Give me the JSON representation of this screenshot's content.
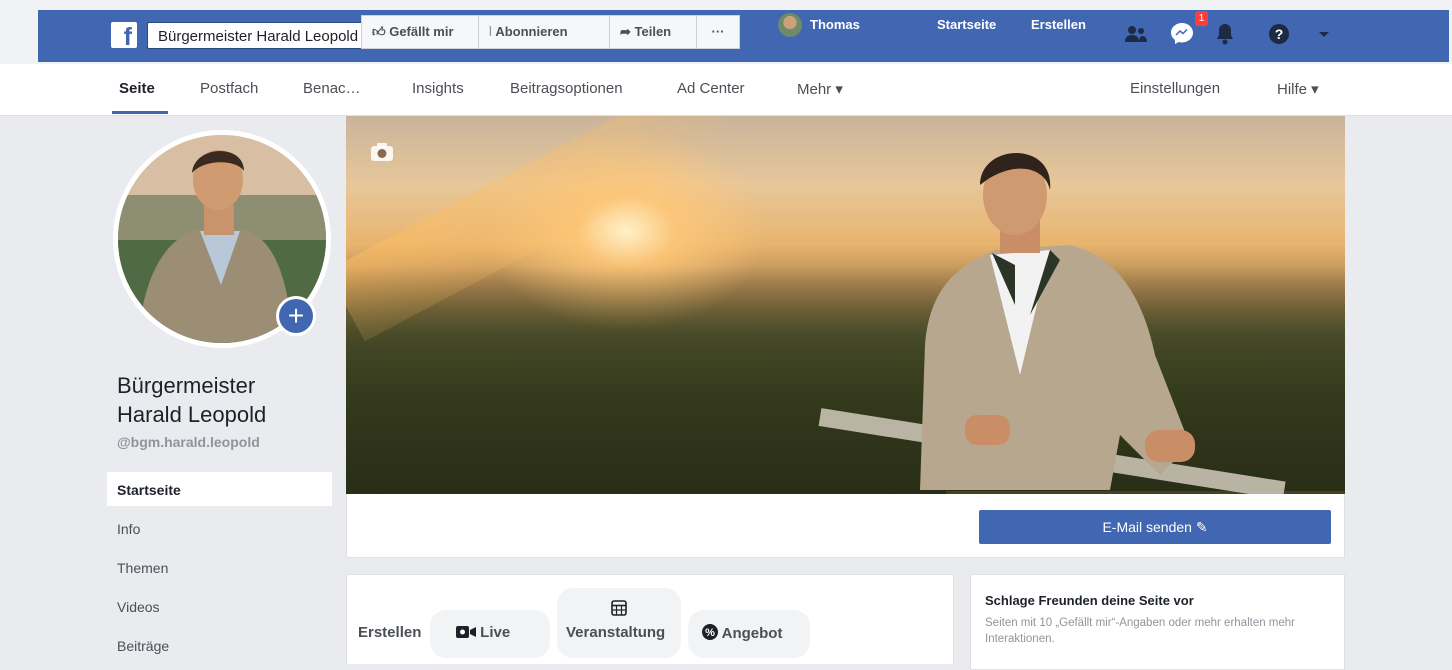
{
  "topbar": {
    "search_value": "Bürgermeister Harald Leopold",
    "user_name": "Thomas",
    "home_label": "Startseite",
    "create_label": "Erstellen",
    "messages_badge": "1"
  },
  "tabs": [
    {
      "label": "Seite"
    },
    {
      "label": "Postfach"
    },
    {
      "label": "Benac…"
    },
    {
      "label": "Insights"
    },
    {
      "label": "Beitragsoptionen"
    },
    {
      "label": "Ad Center"
    },
    {
      "label": "Mehr ▾"
    },
    {
      "label": "Einstellungen"
    },
    {
      "label": "Hilfe ▾"
    }
  ],
  "profile": {
    "name_line1": "Bürgermeister",
    "name_line2": "Harald Leopold",
    "handle": "@bgm.harald.leopold"
  },
  "sidebar": {
    "items": [
      {
        "label": "Startseite"
      },
      {
        "label": "Info"
      },
      {
        "label": "Themen"
      },
      {
        "label": "Videos"
      },
      {
        "label": "Beiträge"
      }
    ]
  },
  "actions": {
    "like_label": "Gefällt mir",
    "follow_label": "Abonnieren",
    "share_label": "Teilen",
    "more_label": "···",
    "email_label": "E-Mail senden"
  },
  "create": {
    "label": "Erstellen",
    "live_label": "Live",
    "event_label": "Veranstaltung",
    "offer_label": "Angebot"
  },
  "suggest": {
    "title": "Schlage Freunden deine Seite vor",
    "text": "Seiten mit 10 „Gefällt mir“-Angaben oder mehr erhalten mehr Interaktionen."
  },
  "colors": {
    "brand_blue": "#4267b2",
    "notification_red": "#fa3e3e"
  }
}
